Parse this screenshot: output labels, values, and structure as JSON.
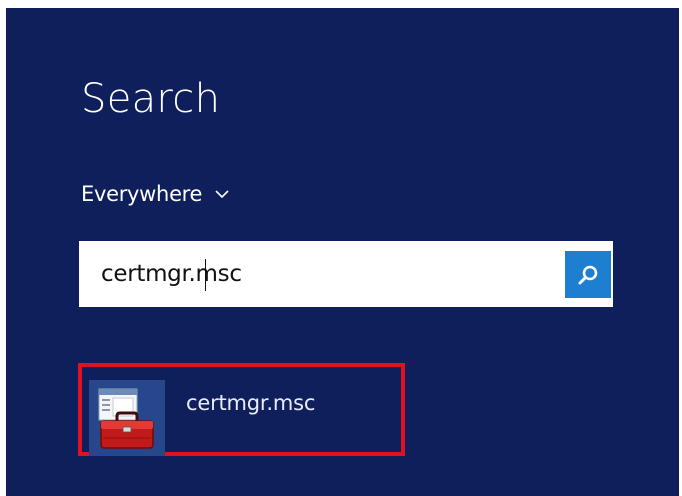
{
  "search": {
    "title": "Search",
    "scope_label": "Everywhere",
    "query": "certmgr.msc"
  },
  "results": [
    {
      "label": "certmgr.msc",
      "icon": "toolbox-icon"
    }
  ],
  "colors": {
    "panel_bg": "#0e1f5b",
    "accent": "#1e7fd0",
    "highlight": "#e1121f",
    "tile_bg": "#27468b"
  }
}
